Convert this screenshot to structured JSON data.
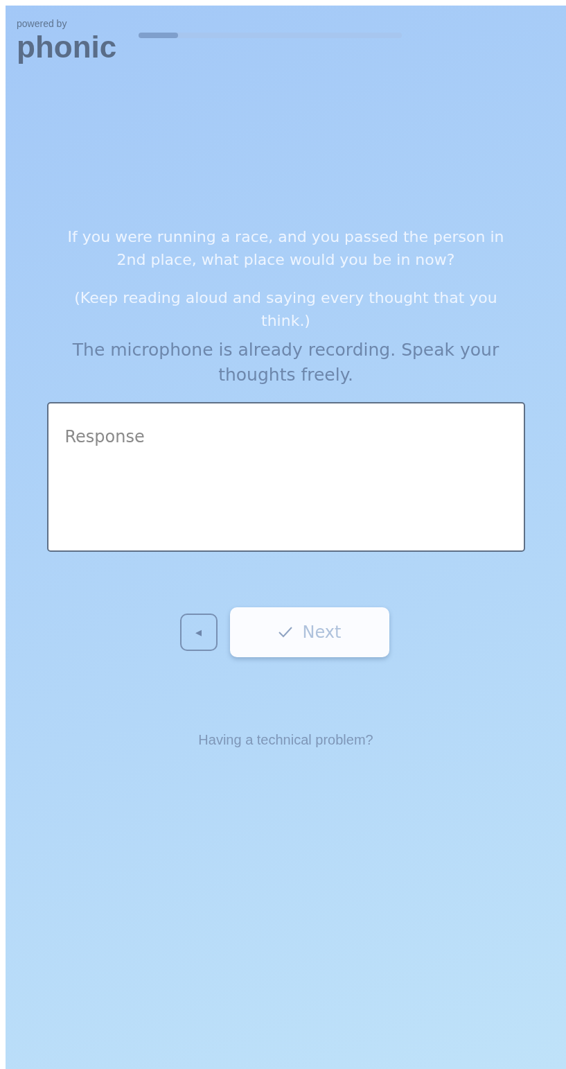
{
  "branding": {
    "caption": "powered by",
    "logo": "phonic"
  },
  "progress": {
    "level": 0.15
  },
  "question": {
    "prompt": "If you were running a race, and you passed the person in 2nd place, what place would you be in now?",
    "instruction": "(Keep reading aloud and saying every thought that you think.)"
  },
  "notice": "The microphone is already recording. Speak your thoughts freely.",
  "response_field": {
    "placeholder": "Response"
  },
  "buttons": {
    "back": {
      "label": "◂"
    },
    "next": {
      "label": "Next",
      "disabled": true
    }
  },
  "help_link": "Having a technical problem?"
}
